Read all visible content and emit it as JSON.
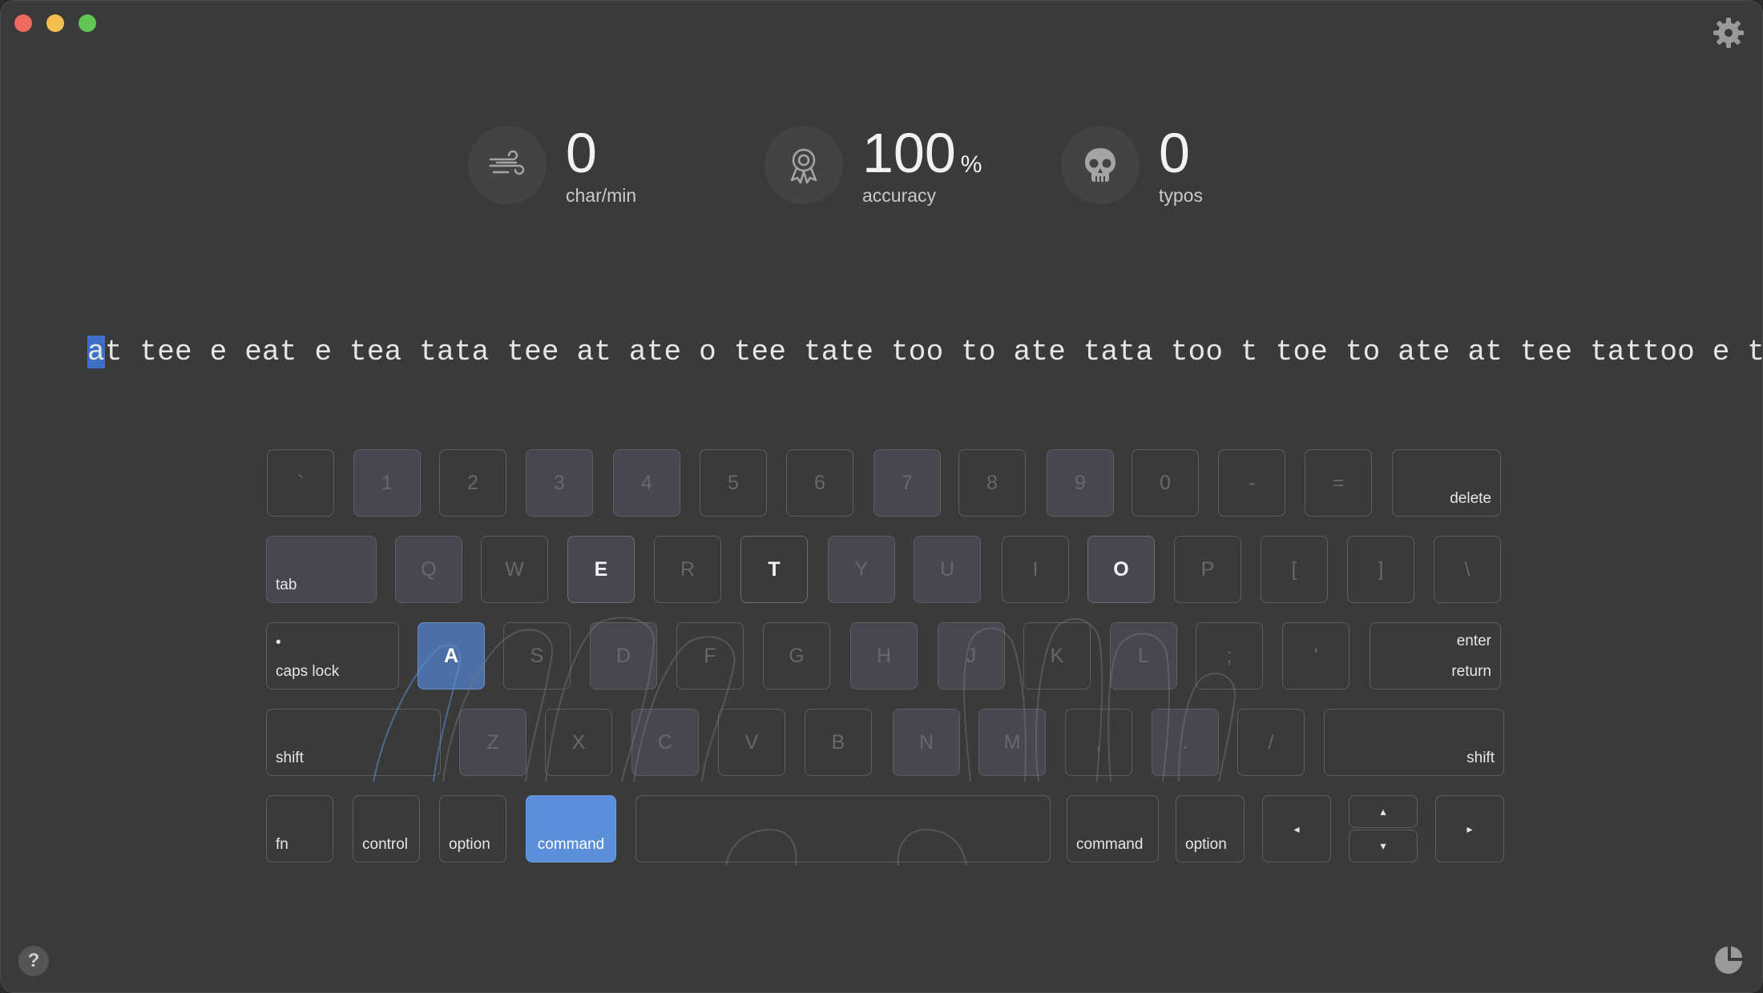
{
  "stats": {
    "speed": {
      "value": "0",
      "label": "char/min",
      "icon": "wind-icon"
    },
    "accuracy": {
      "value": "100",
      "unit": "%",
      "label": "accuracy",
      "icon": "award-icon"
    },
    "typos": {
      "value": "0",
      "label": "typos",
      "icon": "skull-icon"
    }
  },
  "practice": {
    "current_char": "a",
    "text_rest": "t tee e eat e tea tata tee at ate o tee tate too to ate tata too t toe to ate at tee tattoo e too t"
  },
  "keyboard": {
    "row1": [
      "`",
      "1",
      "2",
      "3",
      "4",
      "5",
      "6",
      "7",
      "8",
      "9",
      "0",
      "-",
      "=",
      "delete"
    ],
    "row2": [
      "tab",
      "Q",
      "W",
      "E",
      "R",
      "T",
      "Y",
      "U",
      "I",
      "O",
      "P",
      "[",
      "]",
      "\\"
    ],
    "row3": [
      "caps lock",
      "A",
      "S",
      "D",
      "F",
      "G",
      "H",
      "J",
      "K",
      "L",
      ";",
      "'",
      "enter",
      "return"
    ],
    "row4": [
      "shift",
      "Z",
      "X",
      "C",
      "V",
      "B",
      "N",
      "M",
      ",",
      ".",
      "/",
      "shift"
    ],
    "row5": [
      "fn",
      "control",
      "option",
      "command",
      "",
      "command",
      "option",
      "◂",
      "▴",
      "▾",
      "▸"
    ],
    "caps_dot": "•",
    "highlighted_keys": [
      "A",
      "command"
    ]
  },
  "colors": {
    "accent": "#5b8fd9",
    "background": "#3a3a3a"
  },
  "footer": {
    "help_label": "?"
  }
}
